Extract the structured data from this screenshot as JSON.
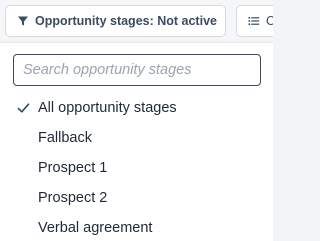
{
  "filters": {
    "stages_chip": {
      "icon": "filter-icon",
      "label": "Opportunity stages: Not active"
    },
    "second_chip": {
      "icon": "list-icon",
      "label": "Ca"
    }
  },
  "dropdown": {
    "search": {
      "placeholder": "Search opportunity stages",
      "value": ""
    },
    "options": [
      {
        "label": "All opportunity stages",
        "selected": true
      },
      {
        "label": "Fallback",
        "selected": false
      },
      {
        "label": "Prospect 1",
        "selected": false
      },
      {
        "label": "Prospect 2",
        "selected": false
      },
      {
        "label": "Verbal agreement",
        "selected": false
      }
    ]
  },
  "colors": {
    "text": "#1f2937",
    "chip_text": "#3c4b63",
    "check": "#3b4a60",
    "placeholder": "#9aa3b2",
    "focus_border": "#3b4a60"
  }
}
